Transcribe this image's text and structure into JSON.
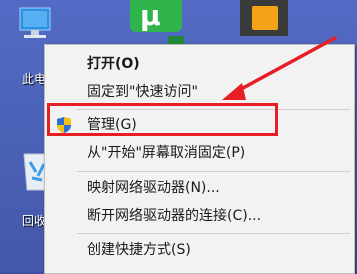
{
  "desktop": {
    "pc_label": "此电",
    "bin_label": "回收"
  },
  "top_tiles": {
    "green_glyph": "µ"
  },
  "menu": {
    "items": [
      {
        "label": "打开(O)"
      },
      {
        "label": "固定到\"快速访问\""
      },
      {
        "label": "管理(G)"
      },
      {
        "label": "从\"开始\"屏幕取消固定(P)"
      },
      {
        "label": "映射网络驱动器(N)..."
      },
      {
        "label": "断开网络驱动器的连接(C)..."
      },
      {
        "label": "创建快捷方式(S)"
      }
    ]
  },
  "annotation": {
    "highlight_color": "#e81e25",
    "highlighted_item": "管理(G)"
  }
}
